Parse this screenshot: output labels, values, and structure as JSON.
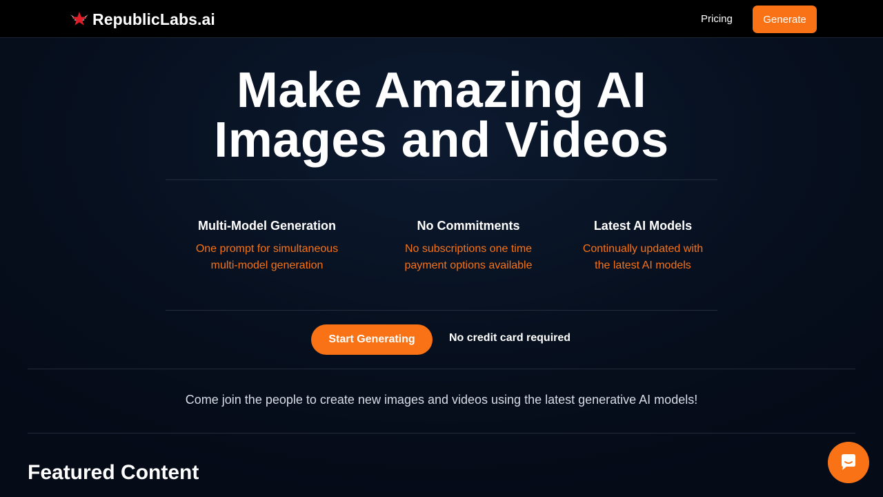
{
  "header": {
    "logo_text": "RepublicLabs.ai",
    "logo_icon": "red-star-wings-icon",
    "nav_pricing": "Pricing",
    "nav_generate": "Generate"
  },
  "hero": {
    "title_line1": "Make Amazing AI",
    "title_line2": "Images and Videos"
  },
  "features": [
    {
      "title": "Multi-Model Generation",
      "desc_line1": "One prompt for simultaneous",
      "desc_line2": "multi-model generation"
    },
    {
      "title": "No Commitments",
      "desc_line1": "No subscriptions one time",
      "desc_line2": "payment options available"
    },
    {
      "title": "Latest AI Models",
      "desc_line1": "Continually updated with",
      "desc_line2": "the latest AI models"
    }
  ],
  "cta": {
    "button_label": "Start Generating",
    "note": "No credit card required"
  },
  "join_text": "Come join the people to create new images and videos using the latest generative AI models!",
  "featured_title": "Featured Content",
  "chat": {
    "icon": "chat-bubble-icon"
  },
  "colors": {
    "accent": "#f97316",
    "header_bg": "#000000",
    "page_bg": "#07101f"
  }
}
